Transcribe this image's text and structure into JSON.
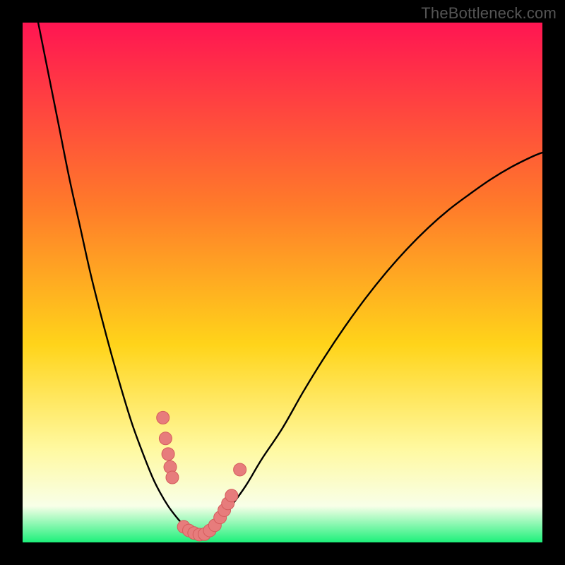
{
  "attribution": "TheBottleneck.com",
  "colors": {
    "frame": "#000000",
    "gradient_top": "#ff1552",
    "gradient_mid1": "#ff7a2a",
    "gradient_mid2": "#ffd41a",
    "gradient_low": "#fff9a0",
    "gradient_palewhite": "#f8ffe8",
    "gradient_green": "#1df07a",
    "curve": "#000000",
    "marker_fill": "#e77c7c",
    "marker_stroke": "#d45c5c"
  },
  "chart_data": {
    "type": "line",
    "title": "",
    "xlabel": "",
    "ylabel": "",
    "ylim": [
      0,
      100
    ],
    "xlim": [
      0,
      100
    ],
    "series": [
      {
        "name": "left-branch",
        "x": [
          3,
          5,
          7,
          9,
          11,
          13,
          15,
          17,
          19,
          21,
          23,
          25,
          26.5,
          28,
          29.5,
          31,
          32.5,
          34
        ],
        "y": [
          100,
          90,
          80,
          70,
          61,
          52,
          44,
          36.5,
          29.5,
          23,
          17.5,
          12.5,
          9.5,
          7,
          5,
          3.3,
          2,
          1
        ]
      },
      {
        "name": "right-branch",
        "x": [
          34,
          36,
          38,
          40,
          43,
          46,
          50,
          54,
          58,
          62,
          66,
          70,
          74,
          78,
          82,
          86,
          90,
          94,
          98,
          100
        ],
        "y": [
          1,
          2.2,
          4.2,
          6.8,
          11,
          16,
          22,
          29,
          35.5,
          41.5,
          47,
          52,
          56.5,
          60.5,
          64,
          67,
          69.8,
          72.2,
          74.2,
          75
        ]
      }
    ],
    "markers": {
      "name": "sample-points",
      "points": [
        {
          "x": 27,
          "y": 24
        },
        {
          "x": 27.5,
          "y": 20
        },
        {
          "x": 28,
          "y": 17
        },
        {
          "x": 28.4,
          "y": 14.5
        },
        {
          "x": 28.8,
          "y": 12.5
        },
        {
          "x": 31,
          "y": 3
        },
        {
          "x": 32,
          "y": 2.3
        },
        {
          "x": 33,
          "y": 1.8
        },
        {
          "x": 34,
          "y": 1.5
        },
        {
          "x": 35,
          "y": 1.6
        },
        {
          "x": 36,
          "y": 2.3
        },
        {
          "x": 37,
          "y": 3.3
        },
        {
          "x": 38,
          "y": 4.8
        },
        {
          "x": 38.8,
          "y": 6.2
        },
        {
          "x": 39.5,
          "y": 7.5
        },
        {
          "x": 40.2,
          "y": 9
        },
        {
          "x": 41.8,
          "y": 14
        }
      ]
    }
  }
}
